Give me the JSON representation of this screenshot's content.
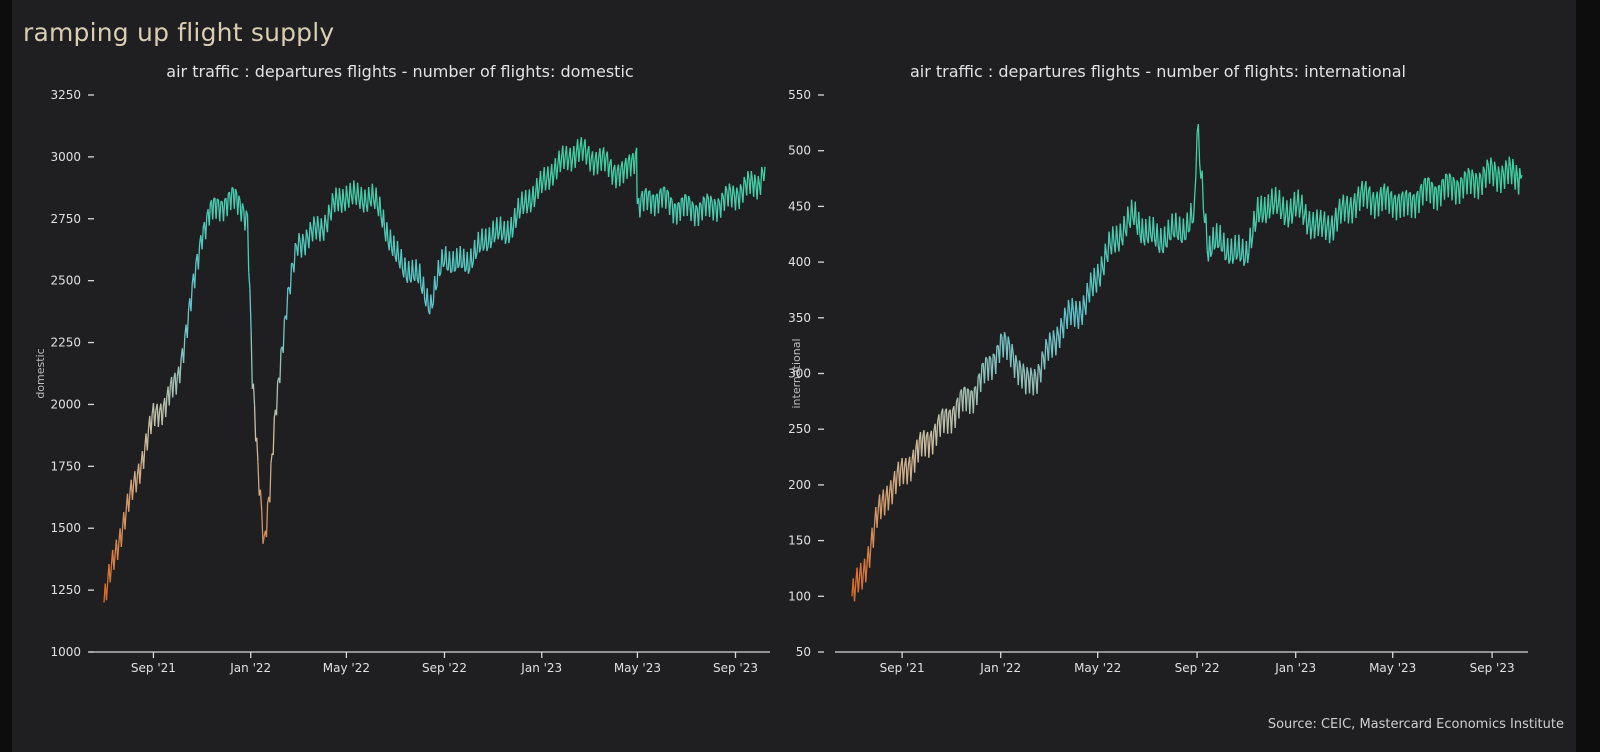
{
  "page": {
    "title": "ramping up flight supply",
    "source": "Source: CEIC, Mastercard Economics Institute"
  },
  "colors": {
    "background": "#1f1f21",
    "low": "#e0621a",
    "mid": "#cbbfa4",
    "mid_high": "#5fc4cf",
    "high": "#3ed1a0"
  },
  "chart_data": [
    {
      "type": "line",
      "title": "air traffic : departures flights - number of flights: domestic",
      "xlabel": "",
      "ylabel": "domestic",
      "ylim": [
        1000,
        3250
      ],
      "yticks": [
        "1000",
        "1250",
        "1500",
        "1750",
        "2000",
        "2250",
        "2500",
        "2750",
        "3000",
        "3250"
      ],
      "xtick_labels": [
        "Sep '21",
        "Jan '22",
        "May '22",
        "Sep '22",
        "Jan '23",
        "May '23",
        "Sep '23"
      ],
      "grid": false,
      "color_scale": "value-mapped gradient (orange low → beige → teal → green high)",
      "series": [
        {
          "x": [
            "2021-07-01",
            "2021-07-15",
            "2021-08-01",
            "2021-08-15",
            "2021-09-01",
            "2021-09-15",
            "2021-10-01",
            "2021-10-15",
            "2021-11-01",
            "2021-11-10",
            "2021-11-20",
            "2021-12-01",
            "2021-12-10",
            "2021-12-20",
            "2021-12-28",
            "2022-01-03",
            "2022-01-10",
            "2022-01-18",
            "2022-01-25",
            "2022-02-01",
            "2022-02-08",
            "2022-02-15",
            "2022-03-01",
            "2022-03-15",
            "2022-04-01",
            "2022-04-15",
            "2022-05-01",
            "2022-05-15",
            "2022-06-01",
            "2022-06-15",
            "2022-07-01",
            "2022-07-15",
            "2022-08-01",
            "2022-08-15",
            "2022-09-01",
            "2022-09-15",
            "2022-10-01",
            "2022-10-15",
            "2022-11-01",
            "2022-11-15",
            "2022-12-01",
            "2022-12-15",
            "2023-01-01",
            "2023-01-15",
            "2023-02-01",
            "2023-02-15",
            "2023-03-01",
            "2023-03-15",
            "2023-04-01",
            "2023-04-15",
            "2023-04-30",
            "2023-05-01",
            "2023-05-15",
            "2023-06-01",
            "2023-06-15",
            "2023-07-01",
            "2023-07-15",
            "2023-08-01",
            "2023-08-15",
            "2023-09-01",
            "2023-09-15",
            "2023-10-01",
            "2023-10-08"
          ],
          "values": [
            1200,
            1400,
            1600,
            1750,
            1950,
            2000,
            2100,
            2350,
            2700,
            2770,
            2800,
            2820,
            2830,
            2810,
            2750,
            2100,
            1750,
            1450,
            1650,
            1950,
            2200,
            2400,
            2650,
            2680,
            2720,
            2800,
            2850,
            2830,
            2840,
            2760,
            2600,
            2550,
            2500,
            2400,
            2600,
            2560,
            2580,
            2630,
            2700,
            2680,
            2760,
            2830,
            2880,
            2950,
            2990,
            3030,
            3000,
            2990,
            2950,
            2930,
            3020,
            2800,
            2830,
            2840,
            2800,
            2800,
            2790,
            2800,
            2820,
            2850,
            2880,
            2900,
            2960
          ]
        }
      ]
    },
    {
      "type": "line",
      "title": "air traffic : departures flights - number of flights: international",
      "xlabel": "",
      "ylabel": "international",
      "ylim": [
        50,
        550
      ],
      "yticks": [
        "50",
        "100",
        "150",
        "200",
        "250",
        "300",
        "350",
        "400",
        "450",
        "500",
        "550"
      ],
      "xtick_labels": [
        "Sep '21",
        "Jan '22",
        "May '22",
        "Sep '22",
        "Jan '23",
        "May '23",
        "Sep '23"
      ],
      "grid": false,
      "color_scale": "value-mapped gradient (orange low → beige → teal → green high)",
      "series": [
        {
          "x": [
            "2021-07-01",
            "2021-07-15",
            "2021-08-01",
            "2021-08-15",
            "2021-09-01",
            "2021-09-15",
            "2021-10-01",
            "2021-10-15",
            "2021-11-01",
            "2021-11-15",
            "2021-12-01",
            "2021-12-15",
            "2022-01-01",
            "2022-01-15",
            "2022-02-01",
            "2022-02-15",
            "2022-03-01",
            "2022-03-15",
            "2022-04-01",
            "2022-04-15",
            "2022-05-01",
            "2022-05-15",
            "2022-06-01",
            "2022-06-15",
            "2022-07-01",
            "2022-07-15",
            "2022-08-01",
            "2022-08-15",
            "2022-08-29",
            "2022-09-01",
            "2022-09-15",
            "2022-10-01",
            "2022-10-15",
            "2022-11-01",
            "2022-11-15",
            "2022-12-01",
            "2022-12-15",
            "2023-01-01",
            "2023-01-15",
            "2023-02-01",
            "2023-02-15",
            "2023-03-01",
            "2023-03-15",
            "2023-04-01",
            "2023-04-15",
            "2023-05-01",
            "2023-05-15",
            "2023-06-01",
            "2023-06-15",
            "2023-07-01",
            "2023-07-15",
            "2023-08-01",
            "2023-08-15",
            "2023-09-01",
            "2023-09-15",
            "2023-10-01",
            "2023-10-08"
          ],
          "values": [
            100,
            120,
            170,
            195,
            210,
            225,
            240,
            250,
            265,
            275,
            285,
            305,
            325,
            320,
            290,
            300,
            320,
            340,
            355,
            360,
            390,
            410,
            430,
            440,
            425,
            420,
            425,
            430,
            440,
            520,
            410,
            420,
            405,
            410,
            440,
            455,
            445,
            450,
            440,
            430,
            435,
            445,
            455,
            460,
            455,
            458,
            450,
            460,
            465,
            465,
            470,
            470,
            475,
            480,
            480,
            478,
            478
          ]
        }
      ]
    }
  ]
}
